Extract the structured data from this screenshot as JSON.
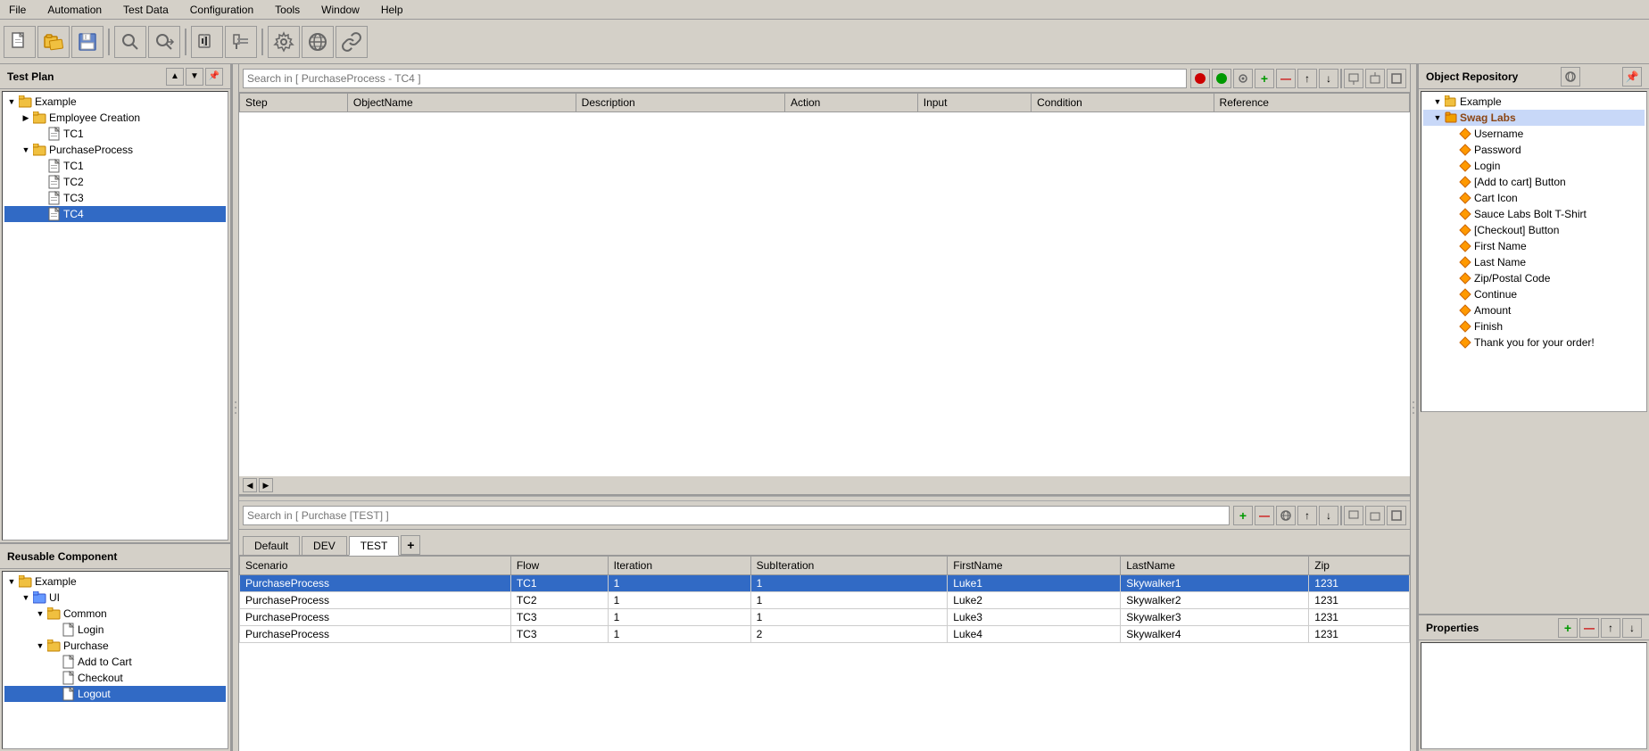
{
  "menubar": {
    "items": [
      "File",
      "Automation",
      "Test Data",
      "Configuration",
      "Tools",
      "Window",
      "Help"
    ]
  },
  "toolbar": {
    "buttons": [
      "new-file",
      "open",
      "save",
      "search",
      "search-next",
      "record",
      "globe",
      "link"
    ]
  },
  "left_panel": {
    "title": "Test Plan",
    "tree": {
      "items": [
        {
          "label": "Example",
          "level": 0,
          "type": "root",
          "expanded": true
        },
        {
          "label": "Employee Creation",
          "level": 1,
          "type": "folder",
          "expanded": false
        },
        {
          "label": "TC1",
          "level": 2,
          "type": "doc"
        },
        {
          "label": "PurchaseProcess",
          "level": 1,
          "type": "folder",
          "expanded": true
        },
        {
          "label": "TC1",
          "level": 2,
          "type": "doc"
        },
        {
          "label": "TC2",
          "level": 2,
          "type": "doc"
        },
        {
          "label": "TC3",
          "level": 2,
          "type": "doc"
        },
        {
          "label": "TC4",
          "level": 2,
          "type": "doc",
          "selected": true
        }
      ]
    }
  },
  "reusable_panel": {
    "title": "Reusable Component",
    "tree": {
      "items": [
        {
          "label": "Example",
          "level": 0,
          "type": "root",
          "expanded": true
        },
        {
          "label": "UI",
          "level": 1,
          "type": "folder",
          "expanded": true
        },
        {
          "label": "Common",
          "level": 2,
          "type": "folder",
          "expanded": true
        },
        {
          "label": "Login",
          "level": 3,
          "type": "doc"
        },
        {
          "label": "Purchase",
          "level": 2,
          "type": "folder",
          "expanded": true
        },
        {
          "label": "Add to Cart",
          "level": 3,
          "type": "doc"
        },
        {
          "label": "Checkout",
          "level": 3,
          "type": "doc"
        },
        {
          "label": "Logout",
          "level": 3,
          "type": "doc",
          "selected": true
        }
      ]
    }
  },
  "top_editor": {
    "search_placeholder": "Search in [ PurchaseProcess - TC4 ]",
    "columns": [
      "Step",
      "ObjectName",
      "Description",
      "Action",
      "Input",
      "Condition",
      "Reference"
    ],
    "rows": []
  },
  "bottom_editor": {
    "search_placeholder": "Search in [ Purchase [TEST] ]",
    "tabs": [
      "Default",
      "DEV",
      "TEST"
    ],
    "active_tab": "TEST",
    "columns": [
      "Scenario",
      "Flow",
      "Iteration",
      "SubIteration",
      "FirstName",
      "LastName",
      "Zip"
    ],
    "rows": [
      {
        "scenario": "PurchaseProcess",
        "flow": "TC1",
        "iteration": "1",
        "subiteration": "1",
        "firstname": "Luke1",
        "lastname": "Skywalker1",
        "zip": "1231",
        "selected": true
      },
      {
        "scenario": "PurchaseProcess",
        "flow": "TC2",
        "iteration": "1",
        "subiteration": "1",
        "firstname": "Luke2",
        "lastname": "Skywalker2",
        "zip": "1231"
      },
      {
        "scenario": "PurchaseProcess",
        "flow": "TC3",
        "iteration": "1",
        "subiteration": "1",
        "firstname": "Luke3",
        "lastname": "Skywalker3",
        "zip": "1231"
      },
      {
        "scenario": "PurchaseProcess",
        "flow": "TC3",
        "iteration": "1",
        "subiteration": "2",
        "firstname": "Luke4",
        "lastname": "Skywalker4",
        "zip": "1231"
      }
    ]
  },
  "object_repo": {
    "title": "Object Repository",
    "tree": {
      "items": [
        {
          "label": "Example",
          "level": 0,
          "type": "root",
          "expanded": true
        },
        {
          "label": "Swag Labs",
          "level": 1,
          "type": "folder",
          "expanded": true,
          "bold": true
        },
        {
          "label": "Username",
          "level": 2,
          "type": "obj"
        },
        {
          "label": "Password",
          "level": 2,
          "type": "obj"
        },
        {
          "label": "Login",
          "level": 2,
          "type": "obj"
        },
        {
          "label": "[Add to cart] Button",
          "level": 2,
          "type": "obj"
        },
        {
          "label": "Cart Icon",
          "level": 2,
          "type": "obj"
        },
        {
          "label": "Sauce Labs Bolt T-Shirt",
          "level": 2,
          "type": "obj"
        },
        {
          "label": "[Checkout] Button",
          "level": 2,
          "type": "obj"
        },
        {
          "label": "First Name",
          "level": 2,
          "type": "obj"
        },
        {
          "label": "Last Name",
          "level": 2,
          "type": "obj"
        },
        {
          "label": "Zip/Postal Code",
          "level": 2,
          "type": "obj"
        },
        {
          "label": "Continue",
          "level": 2,
          "type": "obj"
        },
        {
          "label": "Amount",
          "level": 2,
          "type": "obj"
        },
        {
          "label": "Finish",
          "level": 2,
          "type": "obj"
        },
        {
          "label": "Thank you for your order!",
          "level": 2,
          "type": "obj"
        }
      ]
    }
  },
  "properties": {
    "title": "Properties"
  }
}
